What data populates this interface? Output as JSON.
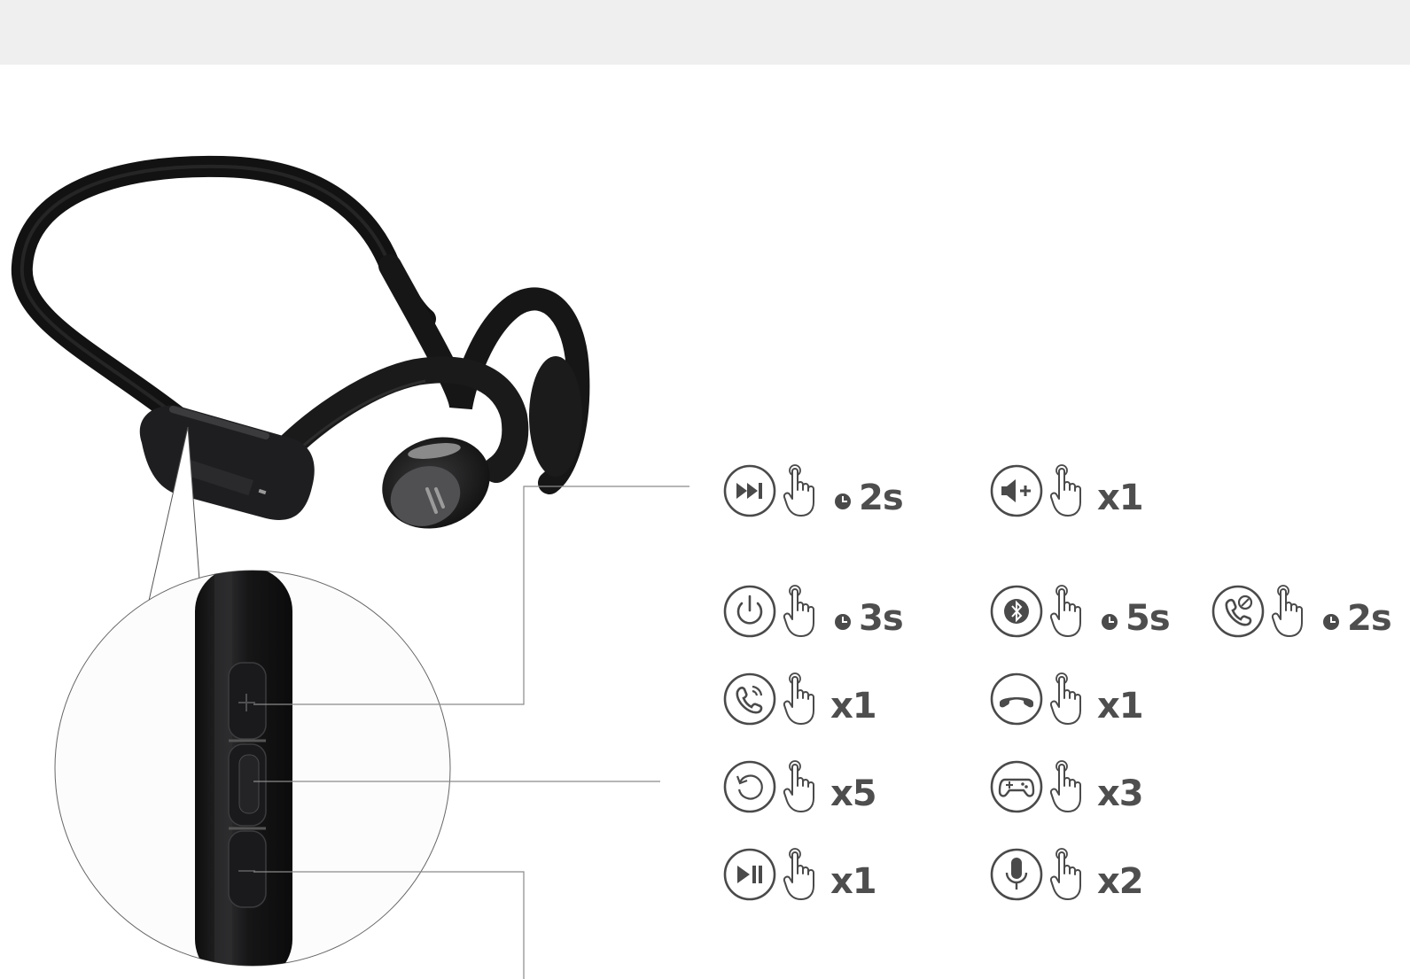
{
  "controls": [
    {
      "id": "next-track",
      "icon": "next-track-icon",
      "gesture": "press-and-hold",
      "value": "2s",
      "timed": true
    },
    {
      "id": "volume-up",
      "icon": "volume-up-icon",
      "gesture": "press",
      "value": "x1",
      "timed": false
    },
    {
      "id": "power",
      "icon": "power-icon",
      "gesture": "press-and-hold",
      "value": "3s",
      "timed": true
    },
    {
      "id": "bluetooth-pairing",
      "icon": "bluetooth-icon",
      "gesture": "press-and-hold",
      "value": "5s",
      "timed": true
    },
    {
      "id": "reject-call",
      "icon": "reject-call-icon",
      "gesture": "press-and-hold",
      "value": "2s",
      "timed": true
    },
    {
      "id": "answer-call",
      "icon": "answer-call-icon",
      "gesture": "press",
      "value": "x1",
      "timed": false
    },
    {
      "id": "end-call",
      "icon": "end-call-icon",
      "gesture": "press",
      "value": "x1",
      "timed": false
    },
    {
      "id": "reset",
      "icon": "reset-icon",
      "gesture": "press",
      "value": "x5",
      "timed": false
    },
    {
      "id": "game-mode",
      "icon": "gamepad-icon",
      "gesture": "press",
      "value": "x3",
      "timed": false
    },
    {
      "id": "play-pause",
      "icon": "play-pause-icon",
      "gesture": "press",
      "value": "x1",
      "timed": false
    },
    {
      "id": "voice-assistant",
      "icon": "microphone-icon",
      "gesture": "press",
      "value": "x2",
      "timed": false
    }
  ],
  "colors": {
    "icon": "#4a4a4a",
    "text": "#4e4e4e",
    "headset": "#1c1c1e",
    "lines": "#8a8a8a",
    "topbar": "#efefef"
  }
}
